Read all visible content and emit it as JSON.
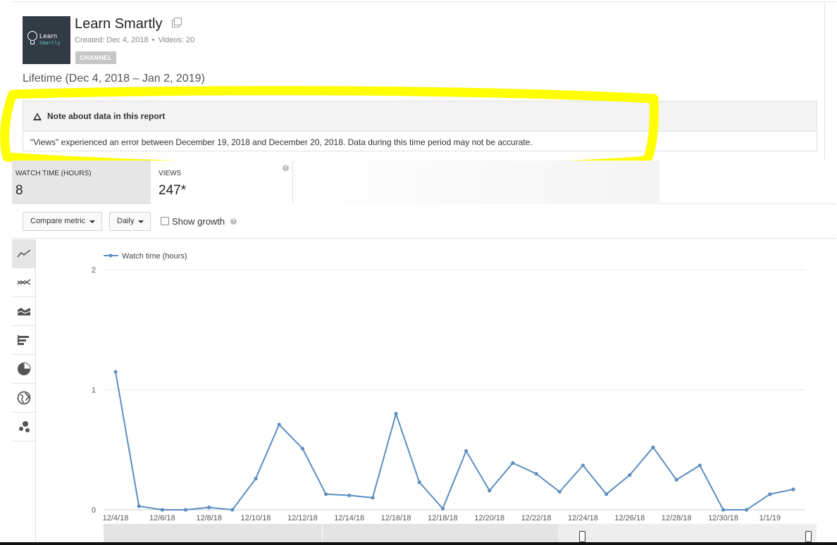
{
  "channel": {
    "name": "Learn Smartly",
    "logo_line1": "Learn",
    "logo_line2": "Smartly",
    "created": "Created: Dec 4, 2018",
    "separator": "•",
    "videos": "Videos: 20",
    "badge": "CHANNEL"
  },
  "range_label": "Lifetime (Dec 4, 2018 – Jan 2, 2019)",
  "note": {
    "title": "Note about data in this report",
    "body": "\"Views\" experienced an error between December 19, 2018 and December 20, 2018. Data during this time period may not be accurate."
  },
  "metrics": [
    {
      "label": "WATCH TIME (HOURS)",
      "value": "8",
      "selected": true
    },
    {
      "label": "VIEWS",
      "value": "247*",
      "selected": false
    }
  ],
  "controls": {
    "compare_label": "Compare metric",
    "interval_label": "Daily",
    "show_growth_label": "Show growth",
    "show_growth_checked": false
  },
  "sidebar_icons": [
    "line-chart-icon",
    "multiline-chart-icon",
    "area-chart-icon",
    "bar-chart-icon",
    "pie-chart-icon",
    "globe-icon",
    "bubble-chart-icon"
  ],
  "colors": {
    "series": "#5b8ec1",
    "highlight": "#ffff00"
  },
  "chart_data": {
    "type": "line",
    "series": [
      {
        "name": "Watch time (hours)",
        "x": [
          "12/4/18",
          "12/5/18",
          "12/6/18",
          "12/7/18",
          "12/8/18",
          "12/9/18",
          "12/10/18",
          "12/11/18",
          "12/12/18",
          "12/13/18",
          "12/14/18",
          "12/15/18",
          "12/16/18",
          "12/17/18",
          "12/18/18",
          "12/19/18",
          "12/20/18",
          "12/21/18",
          "12/22/18",
          "12/23/18",
          "12/24/18",
          "12/25/18",
          "12/26/18",
          "12/27/18",
          "12/28/18",
          "12/29/18",
          "12/30/18",
          "12/31/18",
          "1/1/19",
          "1/2/19"
        ],
        "values": [
          1.15,
          0.03,
          0,
          0,
          0.02,
          0,
          0.26,
          0.71,
          0.51,
          0.13,
          0.12,
          0.1,
          0.8,
          0.23,
          0.01,
          0.49,
          0.16,
          0.39,
          0.3,
          0.15,
          0.37,
          0.13,
          0.29,
          0.52,
          0.25,
          0.37,
          0,
          0,
          0.13,
          0.17
        ]
      }
    ],
    "x_tick_labels": [
      "12/4/18",
      "12/6/18",
      "12/8/18",
      "12/10/18",
      "12/12/18",
      "12/14/18",
      "12/16/18",
      "12/18/18",
      "12/20/18",
      "12/22/18",
      "12/24/18",
      "12/26/18",
      "12/28/18",
      "12/30/18",
      "1/1/19"
    ],
    "y_ticks": [
      "0",
      "1",
      "2"
    ],
    "ylim": [
      0,
      2
    ],
    "grid": true,
    "legend": "top-left"
  }
}
